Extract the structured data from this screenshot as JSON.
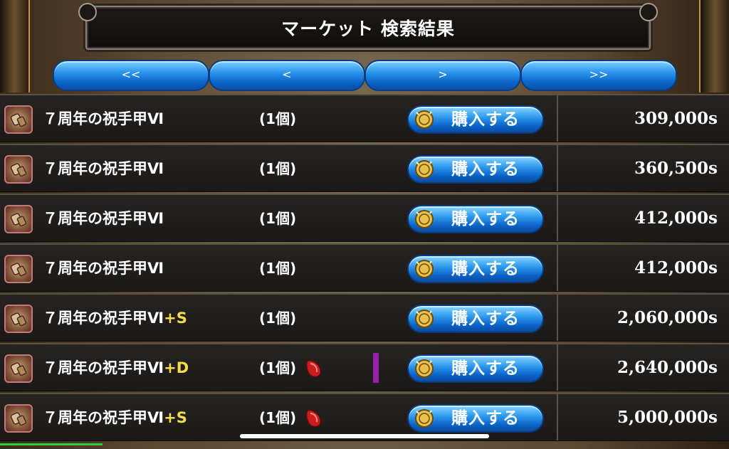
{
  "title": "マーケット 検索結果",
  "nav": {
    "first": "<<",
    "prev": "<",
    "next": ">",
    "last": ">>"
  },
  "buy_label": "購入する",
  "rows": [
    {
      "name": "７周年の祝手甲Ⅵ",
      "suffix": "",
      "qty": "(1個)",
      "price": "309,000s",
      "has_drop": false,
      "has_mark": false
    },
    {
      "name": "７周年の祝手甲Ⅵ",
      "suffix": "",
      "qty": "(1個)",
      "price": "360,500s",
      "has_drop": false,
      "has_mark": false
    },
    {
      "name": "７周年の祝手甲Ⅵ",
      "suffix": "",
      "qty": "(1個)",
      "price": "412,000s",
      "has_drop": false,
      "has_mark": false
    },
    {
      "name": "７周年の祝手甲Ⅵ",
      "suffix": "",
      "qty": "(1個)",
      "price": "412,000s",
      "has_drop": false,
      "has_mark": false
    },
    {
      "name": "７周年の祝手甲Ⅵ",
      "suffix": "+S",
      "qty": "(1個)",
      "price": "2,060,000s",
      "has_drop": false,
      "has_mark": false
    },
    {
      "name": "７周年の祝手甲Ⅵ",
      "suffix": "+D",
      "qty": "(1個)",
      "price": "2,640,000s",
      "has_drop": true,
      "has_mark": true
    },
    {
      "name": "７周年の祝手甲Ⅵ",
      "suffix": "+S",
      "qty": "(1個)",
      "price": "5,000,000s",
      "has_drop": true,
      "has_mark": false
    }
  ],
  "colors": {
    "suffix": "#f2dc4a",
    "button_blue": "#2a94ec",
    "mark_purple": "#9a1cb0"
  },
  "icons": {
    "item": "gauntlet-icon",
    "coin": "coin-icon",
    "drop": "red-drop-icon"
  }
}
